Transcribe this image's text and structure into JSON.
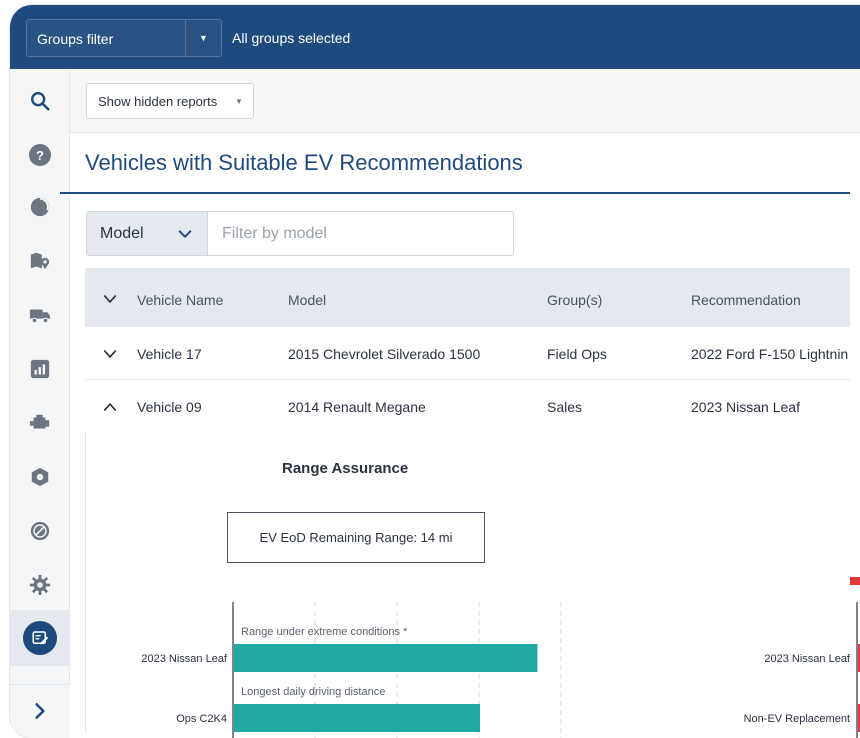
{
  "topbar": {
    "groups_filter_label": "Groups filter",
    "groups_status": "All groups selected"
  },
  "toolbar": {
    "show_hidden_label": "Show hidden reports"
  },
  "page": {
    "title": "Vehicles with Suitable EV Recommendations"
  },
  "filter": {
    "selected_field": "Model",
    "placeholder": "Filter by model"
  },
  "table": {
    "columns": [
      "Vehicle Name",
      "Model",
      "Group(s)",
      "Recommendation"
    ],
    "rows": [
      {
        "vehicle": "Vehicle 17",
        "model": "2015 Chevrolet Silverado 1500",
        "group": "Field Ops",
        "recommendation": "2022 Ford F-150 Lightnin",
        "expanded": false
      },
      {
        "vehicle": "Vehicle 09",
        "model": "2014 Renault Megane",
        "group": "Sales",
        "recommendation": "2023 Nissan Leaf",
        "expanded": true
      }
    ]
  },
  "detail": {
    "chart_title": "Range Assurance",
    "remaining_range": "EV EoD Remaining Range: 14 mi"
  },
  "colors": {
    "brand": "#1f4a7d",
    "bar": "#20a8a3",
    "alert": "#e53935"
  },
  "chart_data": [
    {
      "type": "bar",
      "title": "Range Assurance",
      "categories": [
        "2023 Nissan Leaf",
        "Ops C2K4"
      ],
      "annotations": [
        "Range under extreme conditions *",
        "Longest daily driving distance"
      ],
      "values": [
        3.7,
        3.0
      ],
      "xlim": [
        0,
        4
      ]
    },
    {
      "type": "bar",
      "categories": [
        "2023 Nissan Leaf",
        "Non-EV Replacement"
      ]
    }
  ]
}
